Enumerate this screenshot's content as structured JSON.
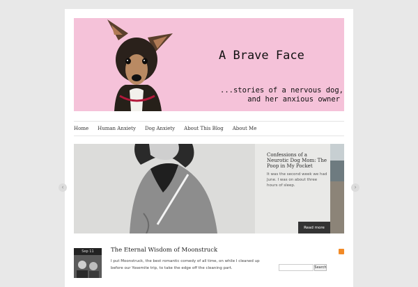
{
  "header": {
    "title": "A Brave Face",
    "tagline_line1": "...stories of a nervous dog,",
    "tagline_line2": "and her anxious owner"
  },
  "nav": {
    "items": [
      "Home",
      "Human Anxiety",
      "Dog Anxiety",
      "About This Blog",
      "About Me"
    ]
  },
  "slider": {
    "title": "Confessions of a Neurotic Dog Mom: The Poop in My Pocket",
    "excerpt": "It was the second week we had June. I was on about three hours of sleep.",
    "read_more": "Read more",
    "prev_arrow": "‹",
    "next_arrow": "›"
  },
  "post": {
    "date": "Sep 11",
    "title": "The Eternal Wisdom of Moonstruck",
    "excerpt": "I put Moonstruck, the best romantic comedy of all time, on while I cleaned up before our Yosemite trip, to take the edge off the cleaning part."
  },
  "sidebar": {
    "search_value": "",
    "search_button": "Search",
    "rss_icon": "rss-icon"
  },
  "colors": {
    "banner_bg": "#f5c2d9",
    "rss": "#f28a26",
    "read_more_bg": "#333333"
  }
}
